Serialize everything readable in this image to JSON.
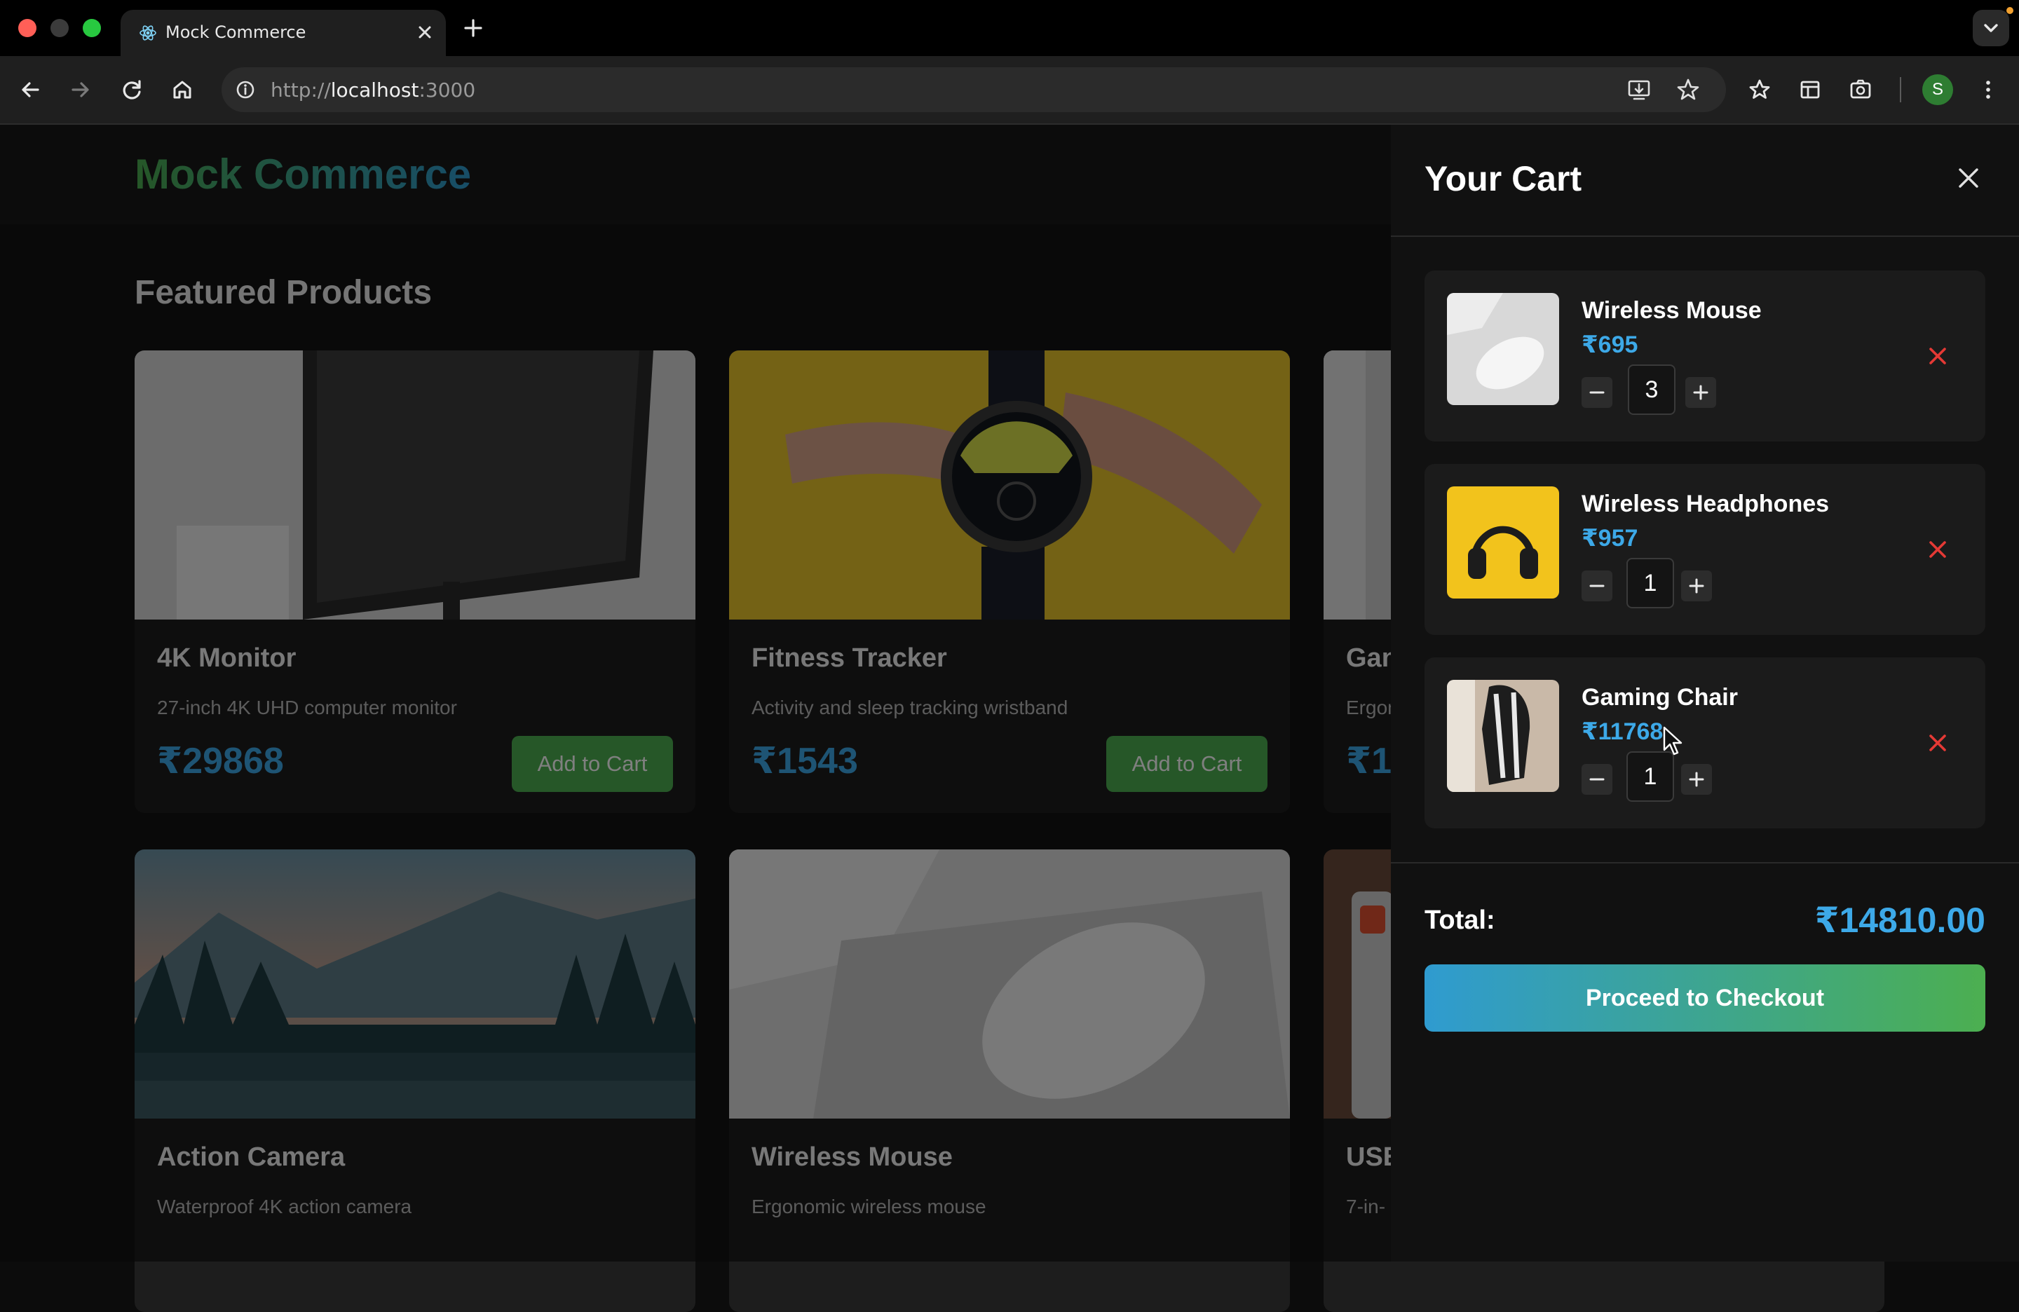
{
  "browser": {
    "tab_title": "Mock Commerce",
    "url_prefix": "http://",
    "url_host": "localhost",
    "url_suffix": ":3000",
    "profile_initial": "S"
  },
  "site": {
    "logo": "Mock Commerce",
    "section_title": "Featured Products"
  },
  "products": [
    {
      "name": "4K Monitor",
      "description": "27-inch 4K UHD computer monitor",
      "price": "₹29868",
      "button": "Add to Cart"
    },
    {
      "name": "Fitness Tracker",
      "description": "Activity and sleep tracking wristband",
      "price": "₹1543",
      "button": "Add to Cart"
    },
    {
      "name": "Gan",
      "description": "Ergon",
      "price": "₹1",
      "button": ""
    },
    {
      "name": "Action Camera",
      "description": "Waterproof 4K action camera",
      "price": "",
      "button": ""
    },
    {
      "name": "Wireless Mouse",
      "description": "Ergonomic wireless mouse",
      "price": "",
      "button": ""
    },
    {
      "name": "USE",
      "description": "7-in-",
      "price": "",
      "button": ""
    }
  ],
  "cart": {
    "title": "Your Cart",
    "items": [
      {
        "name": "Wireless Mouse",
        "price": "₹695",
        "quantity": "3"
      },
      {
        "name": "Wireless Headphones",
        "price": "₹957",
        "quantity": "1"
      },
      {
        "name": "Gaming Chair",
        "price": "₹11768",
        "quantity": "1"
      }
    ],
    "total_label": "Total:",
    "total_value": "₹14810.00",
    "checkout_label": "Proceed to Checkout"
  },
  "colors": {
    "accent_green": "#4caf50",
    "accent_blue": "#3da9e8",
    "remove_red": "#e53935"
  }
}
